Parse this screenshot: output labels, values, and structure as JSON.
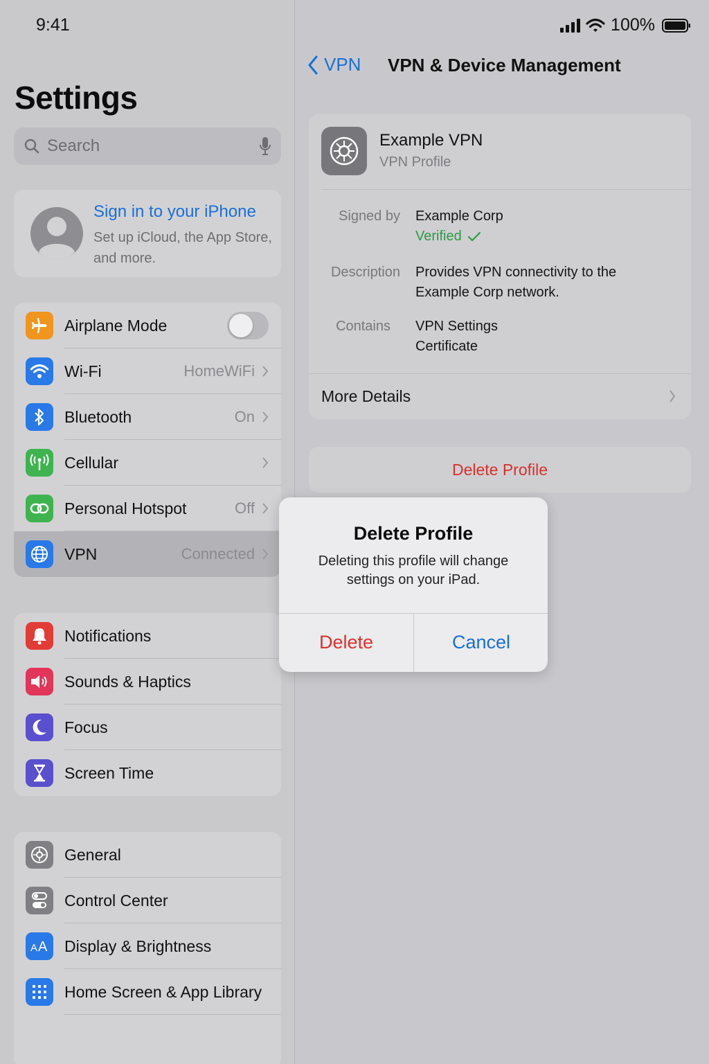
{
  "status": {
    "time": "9:41",
    "battery": "100%"
  },
  "sidebar": {
    "title": "Settings",
    "search_placeholder": "Search",
    "profile": {
      "title": "Sign in to your iPhone",
      "subtitle": "Set up iCloud, the App Store, and more."
    },
    "group1": [
      {
        "label": "Airplane Mode",
        "value": "",
        "icon": "airplane-icon",
        "color": "#f0951e"
      },
      {
        "label": "Wi-Fi",
        "value": "HomeWiFi",
        "icon": "wifi-icon",
        "color": "#2979e8"
      },
      {
        "label": "Bluetooth",
        "value": "On",
        "icon": "bluetooth-icon",
        "color": "#2979e8"
      },
      {
        "label": "Cellular",
        "value": "",
        "icon": "cellular-icon",
        "color": "#3fb34f"
      },
      {
        "label": "Personal Hotspot",
        "value": "Off",
        "icon": "hotspot-icon",
        "color": "#3fb34f"
      },
      {
        "label": "VPN",
        "value": "Connected",
        "icon": "globe-icon",
        "color": "#2979e8"
      }
    ],
    "group2": [
      {
        "label": "Notifications",
        "icon": "bell-icon",
        "color": "#e33b36"
      },
      {
        "label": "Sounds & Haptics",
        "icon": "speaker-icon",
        "color": "#e2355a"
      },
      {
        "label": "Focus",
        "icon": "moon-icon",
        "color": "#5a4fcf"
      },
      {
        "label": "Screen Time",
        "icon": "hourglass-icon",
        "color": "#5a4fcf"
      }
    ],
    "group3": [
      {
        "label": "General",
        "icon": "gear-icon",
        "color": "#7f7f84"
      },
      {
        "label": "Control Center",
        "icon": "switches-icon",
        "color": "#7f7f84"
      },
      {
        "label": "Display & Brightness",
        "icon": "text-size-icon",
        "color": "#2979e8"
      },
      {
        "label": "Home Screen & App Library",
        "icon": "app-grid-icon",
        "color": "#2979e8"
      }
    ]
  },
  "detail": {
    "back_label": "VPN",
    "title": "VPN & Device Management",
    "profile_name": "Example VPN",
    "profile_type": "VPN Profile",
    "signed_by_key": "Signed by",
    "signed_by_value": "Example Corp",
    "verified": "Verified",
    "description_key": "Description",
    "description_line1": "Provides VPN connectivity to the",
    "description_line2": "Example Corp network.",
    "contains_key": "Contains",
    "contains_line1": "VPN Settings",
    "contains_line2": "Certificate",
    "more_details": "More Details",
    "delete_profile": "Delete Profile"
  },
  "alert": {
    "title": "Delete Profile",
    "message_line1": "Deleting this profile will change",
    "message_line2": "settings on your iPad.",
    "delete_label": "Delete",
    "cancel_label": "Cancel"
  }
}
